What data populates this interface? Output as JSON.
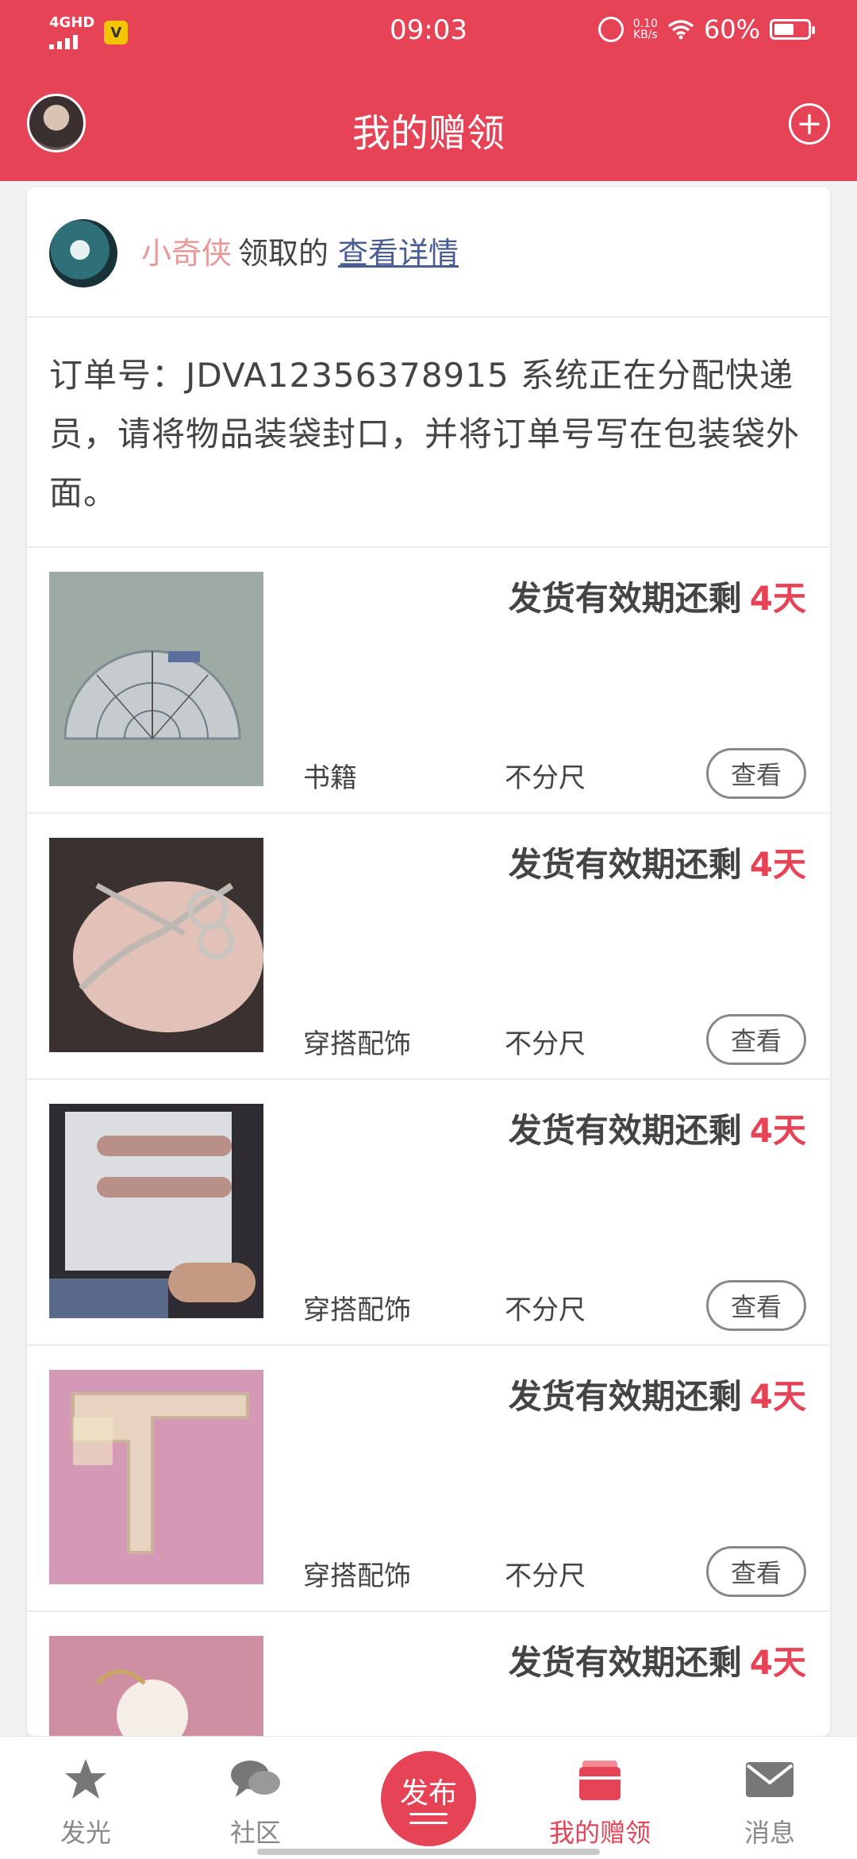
{
  "status_bar": {
    "network": "4GHD",
    "time": "09:03",
    "speed_value": "0.10",
    "speed_unit": "KB/s",
    "battery": "60%",
    "battery_level": 0.6
  },
  "header": {
    "title": "我的赠领"
  },
  "claim": {
    "username": "小奇侠",
    "action": "领取的",
    "detail_link": "查看详情"
  },
  "notice": "订单号：JDVA12356378915 系统正在分配快递员，请将物品装袋封口，并将订单号写在包装袋外面。",
  "items": [
    {
      "deadline": "发货有效期还剩",
      "days": "4天",
      "category": "书籍",
      "size": "不分尺",
      "button": "查看"
    },
    {
      "deadline": "发货有效期还剩",
      "days": "4天",
      "category": "穿搭配饰",
      "size": "不分尺",
      "button": "查看"
    },
    {
      "deadline": "发货有效期还剩",
      "days": "4天",
      "category": "穿搭配饰",
      "size": "不分尺",
      "button": "查看"
    },
    {
      "deadline": "发货有效期还剩",
      "days": "4天",
      "category": "穿搭配饰",
      "size": "不分尺",
      "button": "查看"
    },
    {
      "deadline": "发货有效期还剩",
      "days": "4天"
    }
  ],
  "nav": {
    "tab1": "发光",
    "tab2": "社区",
    "publish": "发布",
    "tab4": "我的赠领",
    "tab5": "消息"
  },
  "colors": {
    "accent": "#e64357",
    "link": "#4a5d92",
    "username": "#e89a9a"
  }
}
